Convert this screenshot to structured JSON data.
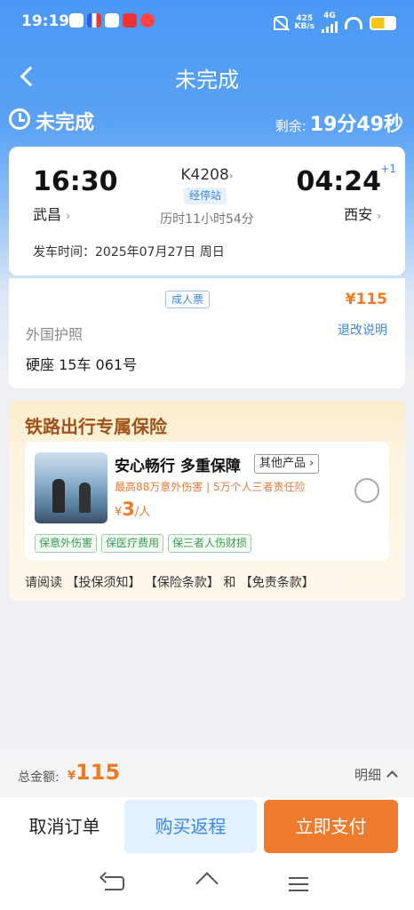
{
  "statusbar": {
    "time": "19:19",
    "net_speed_value": "425",
    "net_speed_unit": "KB/s",
    "net_type": "4G"
  },
  "nav": {
    "title": "未完成"
  },
  "order_status": {
    "label": "未完成",
    "remaining_label": "剩余:",
    "remaining_time": "19分49秒"
  },
  "train": {
    "departure_time": "16:30",
    "departure_station": "武昌",
    "arrival_time": "04:24",
    "arrival_station": "西安",
    "day_offset": "+1",
    "number": "K4208",
    "via_label": "经停站",
    "duration": "历时11小时54分",
    "departure_date": "发车时间：2025年07月27日 周日"
  },
  "ticket": {
    "type": "成人票",
    "price": "¥115",
    "document": "外国护照",
    "refund_label": "退改说明",
    "seat": "硬座 15车 061号"
  },
  "insurance": {
    "section_title": "铁路出行专属保险",
    "product_name": "安心畅行 多重保障",
    "other_products": "其他产品",
    "description": "最高88万意外伤害 | 5万个人三者责任险",
    "price_symbol": "¥",
    "price": "3",
    "price_unit": "/人",
    "tags": [
      "保意外伤害",
      "保医疗费用",
      "保三者人伤财损"
    ],
    "read_prefix": "请阅读",
    "notice_link": "【投保须知】",
    "terms_link": "【保险条款】",
    "and": "和",
    "exemption_link": "【免责条款】"
  },
  "footer": {
    "total_label": "总金额:",
    "currency": "¥",
    "total_amount": "115",
    "detail_label": "明细",
    "cancel_label": "取消订单",
    "return_label": "购买返程",
    "pay_label": "立即支付"
  },
  "colors": {
    "primary_blue": "#4a98f5",
    "accent_orange": "#ef7b2d",
    "link_blue": "#3b86e8"
  }
}
